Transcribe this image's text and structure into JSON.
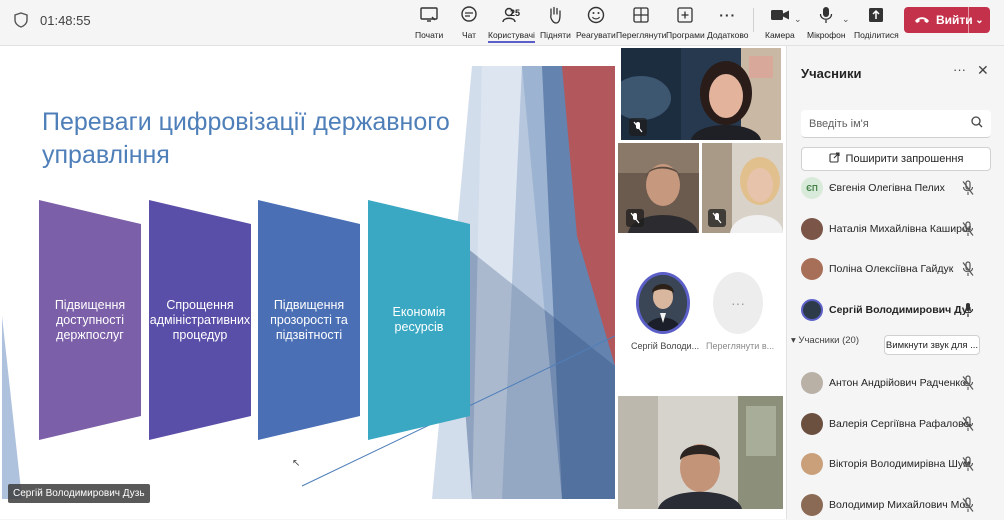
{
  "topbar": {
    "timer": "01:48:55",
    "buttons": [
      {
        "id": "more",
        "label": "Почати",
        "icon": "share-screen-icon"
      },
      {
        "id": "chat",
        "label": "Чат",
        "icon": "chat-icon"
      },
      {
        "id": "people",
        "label": "Користувачі",
        "icon": "people-icon",
        "badge": "25",
        "active": true
      },
      {
        "id": "raise",
        "label": "Підняти",
        "icon": "raise-hand-icon"
      },
      {
        "id": "react",
        "label": "Реагувати",
        "icon": "react-icon"
      },
      {
        "id": "view",
        "label": "Переглянути",
        "icon": "view-icon"
      },
      {
        "id": "apps",
        "label": "Програми",
        "icon": "apps-icon"
      },
      {
        "id": "more2",
        "label": "Додатково",
        "icon": "more-icon"
      },
      {
        "id": "camera",
        "label": "Камера",
        "icon": "camera-icon"
      },
      {
        "id": "mic",
        "label": "Мікрофон",
        "icon": "mic-icon"
      },
      {
        "id": "share",
        "label": "Поділитися",
        "icon": "share-icon"
      }
    ],
    "leave_label": "Вийти",
    "leave_color": "#c4314b"
  },
  "slide": {
    "title": "Переваги цифровізації державного управління",
    "steps": [
      {
        "text": "Підвищення доступності держпослуг",
        "color": "#7b5fa8"
      },
      {
        "text": "Спрощення адміністративних процедур",
        "color": "#5a4fa8"
      },
      {
        "text": "Підвищення прозорості та підзвітності",
        "color": "#4a6fb5"
      },
      {
        "text": "Економія ресурсів",
        "color": "#3aa8c3"
      }
    ]
  },
  "stage": {
    "presenter_name": "Сергій Володимирович Дузь",
    "tile_avatar_name": "Сергій Володи...",
    "tile_view_more": "Переглянути в..."
  },
  "panel": {
    "title": "Учасники",
    "search_placeholder": "Введіть ім'я",
    "share_invite": "Поширити запрошення",
    "top_participants": [
      {
        "name": "Євгенія Олегівна Пелих",
        "initials": "ЄП",
        "muted": true
      },
      {
        "name": "Наталія Михайлівна Каширова",
        "muted": true
      },
      {
        "name": "Поліна Олексіївна Гайдук",
        "muted": true
      },
      {
        "name": "Сергій Володимирович Дузь",
        "muted": false,
        "bold": true
      }
    ],
    "section_label": "Учасники (20)",
    "mute_all_label": "Вимкнути звук для ...",
    "participants": [
      {
        "name": "Антон Андрійович Радченко",
        "muted": true
      },
      {
        "name": "Валерія Сергіївна Рафаловська",
        "muted": true
      },
      {
        "name": "Вікторія Володимирівна Шум...",
        "muted": true
      },
      {
        "name": "Володимир Михайлович Мо...",
        "muted": true
      }
    ]
  }
}
